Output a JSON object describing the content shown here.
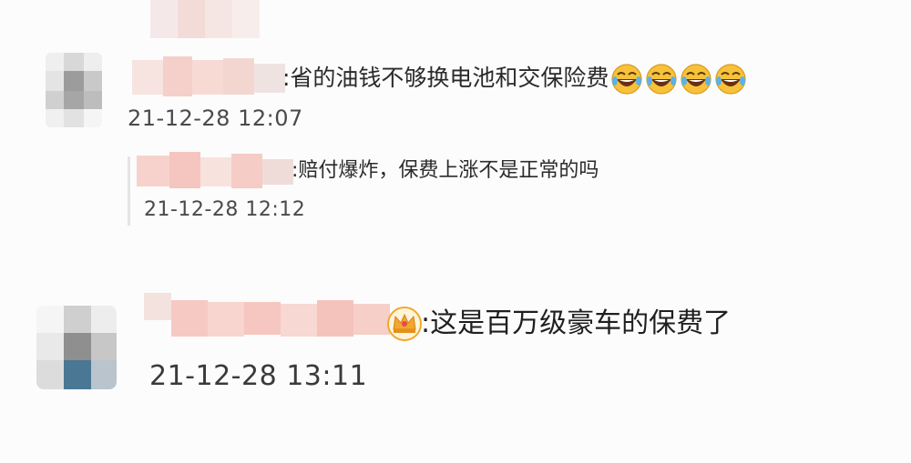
{
  "comments": [
    {
      "text": ":省的油钱不够换电池和交保险费",
      "time": "21-12-28 12:07",
      "emoji_icons": [
        "laughing-tears-emoji",
        "laughing-tears-emoji",
        "laughing-tears-emoji",
        "laughing-tears-emoji"
      ]
    },
    {
      "text": ":赔付爆炸，保费上涨不是正常的吗",
      "time": "21-12-28 12:12"
    },
    {
      "text": ":这是百万级豪车的保费了",
      "time": "21-12-28 13:11",
      "badge_icon": "crown-icon"
    }
  ],
  "colors": {
    "text": "#2a2a2a",
    "timestamp": "#4a4a4a",
    "emoji_face": "#f7c23a",
    "crown": "#f2a72d",
    "mosaic_pink": "#f7c9c2",
    "mosaic_gray": "#a9a9a9",
    "mosaic_blue": "#4a7794"
  }
}
